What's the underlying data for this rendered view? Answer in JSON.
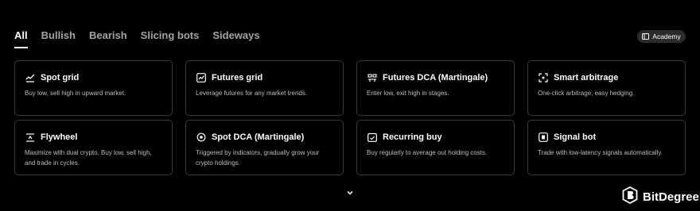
{
  "tabs": [
    {
      "label": "All",
      "active": true
    },
    {
      "label": "Bullish",
      "active": false
    },
    {
      "label": "Bearish",
      "active": false
    },
    {
      "label": "Slicing bots",
      "active": false
    },
    {
      "label": "Sideways",
      "active": false
    }
  ],
  "academy": {
    "label": "Academy",
    "icon": "book-icon"
  },
  "cards": [
    {
      "title": "Spot grid",
      "desc": "Buy low, sell high in upward market.",
      "icon": "chart-line-icon"
    },
    {
      "title": "Futures grid",
      "desc": "Leverage futures for any market trends.",
      "icon": "chart-box-icon"
    },
    {
      "title": "Futures DCA (Martingale)",
      "desc": "Enter low, exit high in stages.",
      "icon": "stages-icon"
    },
    {
      "title": "Smart arbitrage",
      "desc": "One-click arbitrage, easy hedging.",
      "icon": "corners-icon"
    },
    {
      "title": "Flywheel",
      "desc": "Maximize with dual crypto. Buy low, sell high, and trade in cycles.",
      "icon": "flywheel-icon"
    },
    {
      "title": "Spot DCA (Martingale)",
      "desc": "Triggered by indicators, gradually grow your crypto holdings.",
      "icon": "target-icon"
    },
    {
      "title": "Recurring buy",
      "desc": "Buy regularly to average out holding costs.",
      "icon": "calendar-icon"
    },
    {
      "title": "Signal bot",
      "desc": "Trade with low-latency signals automatically.",
      "icon": "signal-icon"
    }
  ],
  "expand": {
    "icon": "chevron-down-icon"
  },
  "watermark": {
    "text": "BitDegree",
    "icon": "bitdegree-logo-icon"
  },
  "colors": {
    "background": "#000000",
    "card_border": "#3a3a3a",
    "tab_inactive": "#a3a3a3",
    "academy_bg": "#2c2c2c"
  }
}
